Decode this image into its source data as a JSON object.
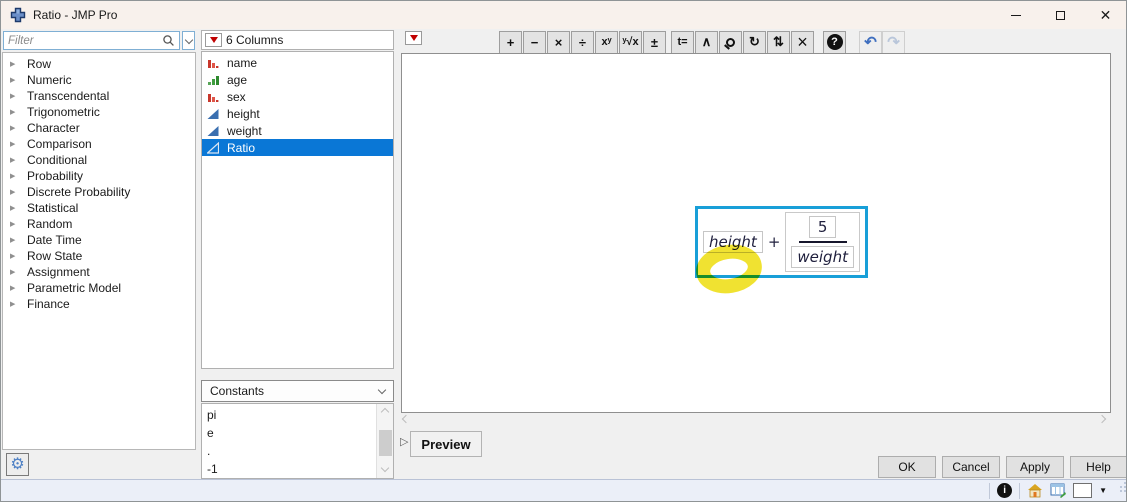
{
  "window": {
    "title": "Ratio - JMP Pro"
  },
  "filter": {
    "placeholder": "Filter"
  },
  "functions": {
    "items": [
      "Row",
      "Numeric",
      "Transcendental",
      "Trigonometric",
      "Character",
      "Comparison",
      "Conditional",
      "Probability",
      "Discrete Probability",
      "Statistical",
      "Random",
      "Date Time",
      "Row State",
      "Assignment",
      "Parametric Model",
      "Finance"
    ]
  },
  "columns": {
    "header": "6 Columns",
    "items": [
      {
        "name": "name",
        "type": "nominal"
      },
      {
        "name": "age",
        "type": "ordinal"
      },
      {
        "name": "sex",
        "type": "nominal"
      },
      {
        "name": "height",
        "type": "continuous"
      },
      {
        "name": "weight",
        "type": "continuous"
      },
      {
        "name": "Ratio",
        "type": "continuous-empty",
        "selected": true
      }
    ]
  },
  "constants": {
    "selector": "Constants",
    "items": [
      "pi",
      "e",
      ".",
      "-1"
    ]
  },
  "toolbar": {
    "group1": [
      {
        "name": "add",
        "glyph": "+"
      },
      {
        "name": "subtract",
        "glyph": "−"
      },
      {
        "name": "multiply",
        "glyph": "×"
      },
      {
        "name": "divide",
        "glyph": "÷"
      },
      {
        "name": "power",
        "glyph": "xʸ"
      },
      {
        "name": "root",
        "glyph": "ʸ√x"
      },
      {
        "name": "unary-sign",
        "glyph": "±"
      }
    ],
    "group2": [
      {
        "name": "local-assignment",
        "glyph": "t="
      },
      {
        "name": "peel-expression",
        "glyph": "∧"
      },
      {
        "name": "magnify",
        "glyph": ""
      },
      {
        "name": "switch-terms",
        "glyph": "↻"
      },
      {
        "name": "boxing",
        "glyph": "⇅"
      },
      {
        "name": "delete",
        "glyph": "×"
      }
    ],
    "help": "?",
    "undo": "↶",
    "redo": "↷"
  },
  "formula": {
    "left_operand": "height",
    "operator": "+",
    "numerator": "5",
    "denominator": "weight"
  },
  "preview": {
    "label": "Preview"
  },
  "actions": {
    "ok": "OK",
    "cancel": "Cancel",
    "apply": "Apply",
    "help": "Help"
  },
  "colors": {
    "selection_blue": "#0a77d6",
    "formula_selection_blue": "#189fd8",
    "highlight_yellow": "#efe01f",
    "titlebar": "#f8f1ec"
  }
}
